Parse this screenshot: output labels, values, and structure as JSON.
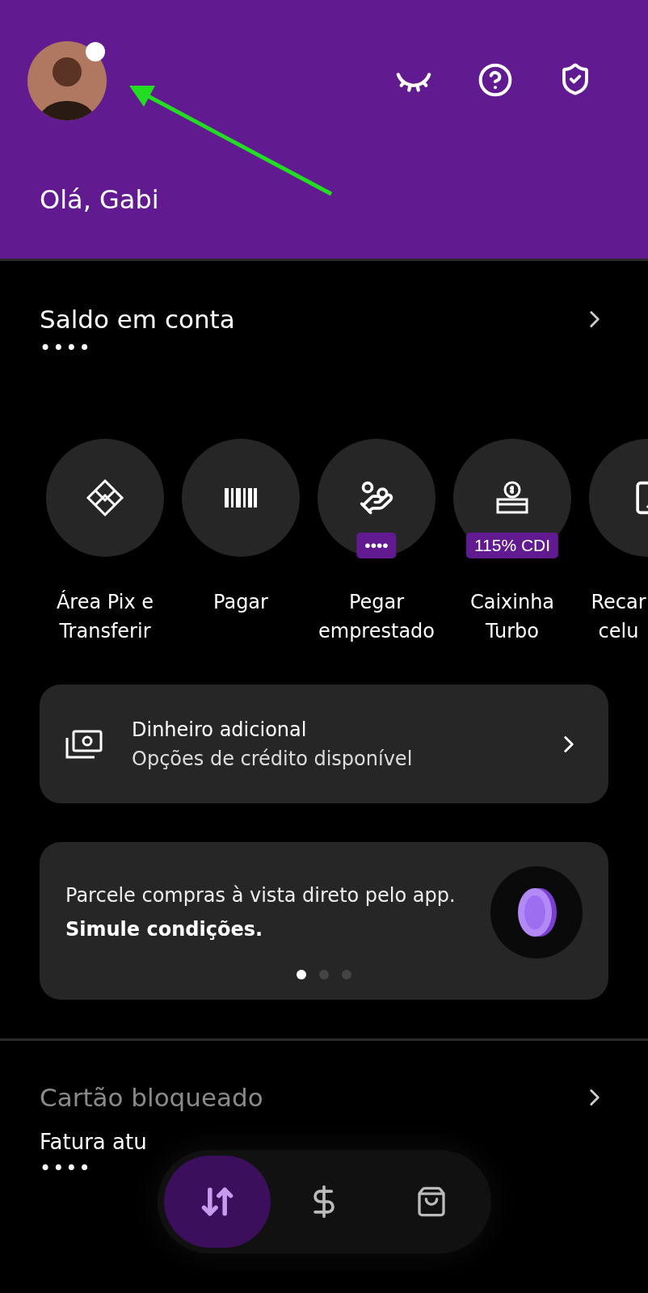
{
  "header": {
    "greeting": "Olá, Gabi",
    "notification": true
  },
  "balance": {
    "title": "Saldo em conta",
    "value": "••••"
  },
  "shortcuts": [
    {
      "kind": "pix",
      "lines": [
        "Área Pix e",
        "Transferir"
      ]
    },
    {
      "kind": "barcode",
      "lines": [
        "Pagar"
      ]
    },
    {
      "kind": "loan",
      "lines": [
        "Pegar",
        "emprestado"
      ],
      "badge": "••••"
    },
    {
      "kind": "box",
      "lines": [
        "Caixinha",
        "Turbo"
      ],
      "badge": "115% CDI"
    },
    {
      "kind": "phone",
      "lines": [
        "Recar",
        "celu"
      ]
    }
  ],
  "credit_card": {
    "title": "Dinheiro adicional",
    "subtitle": "Opções de crédito disponível"
  },
  "carousel": {
    "text": "Parcele compras à vista direto pelo app. **Simule condições.**",
    "dots": [
      {
        "selected": true
      },
      {
        "selected": false
      },
      {
        "selected": false
      }
    ]
  },
  "card_section": {
    "title": "Cartão bloqueado",
    "label": "Fatura atu",
    "value": "••••"
  },
  "nav": [
    {
      "kind": "transfer",
      "selected": true
    },
    {
      "kind": "money",
      "selected": false
    },
    {
      "kind": "shop",
      "selected": false
    }
  ]
}
